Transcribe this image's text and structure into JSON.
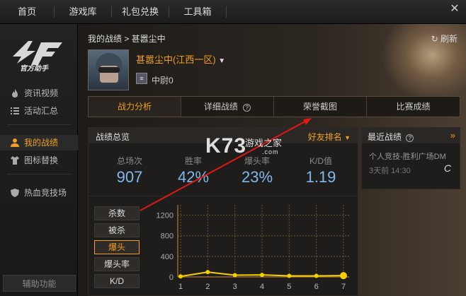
{
  "topnav": {
    "tabs": [
      "首页",
      "游戏库",
      "礼包兑换",
      "工具箱"
    ]
  },
  "sidebar": {
    "logo_text": "官方助手",
    "items": [
      {
        "label": "资讯视频",
        "icon": "flame-icon"
      },
      {
        "label": "活动汇总",
        "icon": "list-icon"
      },
      {
        "label": "我的战绩",
        "icon": "user-icon"
      },
      {
        "label": "图标替换",
        "icon": "shirt-icon"
      },
      {
        "label": "热血竞技场",
        "icon": "shield-icon"
      }
    ],
    "assist_label": "辅助功能"
  },
  "header": {
    "breadcrumb": "我的战绩 > 甚嚣尘中",
    "refresh_label": "刷新",
    "player_name": "甚嚣尘中(江西一区)",
    "rank_label": "中尉0"
  },
  "tabs": [
    "战力分析",
    "详细战绩",
    "荣誉截图",
    "比赛成绩"
  ],
  "overview": {
    "title": "战绩总览",
    "friend_rank": "好友排名",
    "stats": [
      {
        "label": "总场次",
        "value": "907"
      },
      {
        "label": "胜率",
        "value": "42%"
      },
      {
        "label": "爆头率",
        "value": "23%"
      },
      {
        "label": "K/D值",
        "value": "1.19"
      }
    ],
    "buttons": [
      "杀数",
      "被杀",
      "爆头",
      "爆头率",
      "K/D"
    ],
    "active_button": "爆头"
  },
  "recent": {
    "title": "最近战绩",
    "item": "个人竞技-胜利广场DM",
    "time": "3天前 14:30",
    "grade": "C"
  },
  "watermark": {
    "logo": "K73",
    "cn": "游戏之家",
    "url": ".com"
  },
  "chart_data": {
    "type": "line",
    "categories": [
      "1",
      "2",
      "3",
      "4",
      "5",
      "6",
      "7"
    ],
    "values": [
      10,
      95,
      35,
      40,
      20,
      20,
      25
    ],
    "yticks": [
      "0",
      "400",
      "800",
      "1200"
    ],
    "ylim": [
      0,
      1400
    ],
    "line_color": "#f5d000",
    "grid_color": "#c98c3c"
  }
}
